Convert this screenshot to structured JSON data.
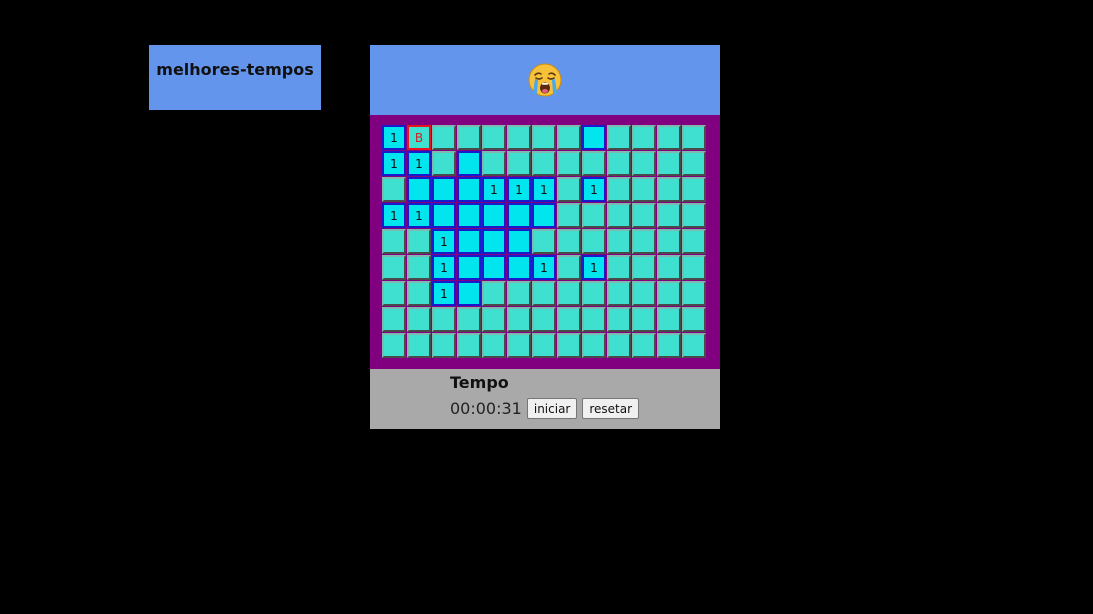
{
  "best_times": {
    "title": "melhores-tempos"
  },
  "game": {
    "face_icon": "crying-face-icon",
    "status": "lost",
    "rows": 9,
    "cols": 13,
    "board": [
      [
        "1",
        "B",
        "#",
        "#",
        "#",
        "#",
        "#",
        "#",
        "o",
        "#",
        "#",
        "#",
        "#"
      ],
      [
        "1",
        "1",
        "#",
        "o",
        "#",
        "#",
        "#",
        "#",
        "#",
        "#",
        "#",
        "#",
        "#"
      ],
      [
        "#",
        "o",
        "o",
        "o",
        "1",
        "1",
        "1",
        "#",
        "1",
        "#",
        "#",
        "#",
        "#"
      ],
      [
        "1",
        "1",
        "o",
        "o",
        "o",
        "o",
        "o",
        "#",
        "#",
        "#",
        "#",
        "#",
        "#"
      ],
      [
        "#",
        "#",
        "1",
        "o",
        "o",
        "o",
        "#",
        "#",
        "#",
        "#",
        "#",
        "#",
        "#"
      ],
      [
        "#",
        "#",
        "1",
        "o",
        "o",
        "o",
        "1",
        "#",
        "1",
        "#",
        "#",
        "#",
        "#"
      ],
      [
        "#",
        "#",
        "1",
        "o",
        "#",
        "#",
        "#",
        "#",
        "#",
        "#",
        "#",
        "#",
        "#"
      ],
      [
        "#",
        "#",
        "#",
        "#",
        "#",
        "#",
        "#",
        "#",
        "#",
        "#",
        "#",
        "#",
        "#"
      ],
      [
        "#",
        "#",
        "#",
        "#",
        "#",
        "#",
        "#",
        "#",
        "#",
        "#",
        "#",
        "#",
        "#"
      ]
    ],
    "colors": {
      "header_bg": "#6495ed",
      "board_bg": "#800080",
      "hidden_cell": "#40e0d0",
      "open_cell": "#00e5ee",
      "open_border": "#1a1acd",
      "bomb_border": "#e8141e",
      "footer_bg": "#a9a9a9"
    }
  },
  "timer": {
    "label": "Tempo",
    "value": "00:00:31",
    "start_label": "iniciar",
    "reset_label": "resetar"
  }
}
